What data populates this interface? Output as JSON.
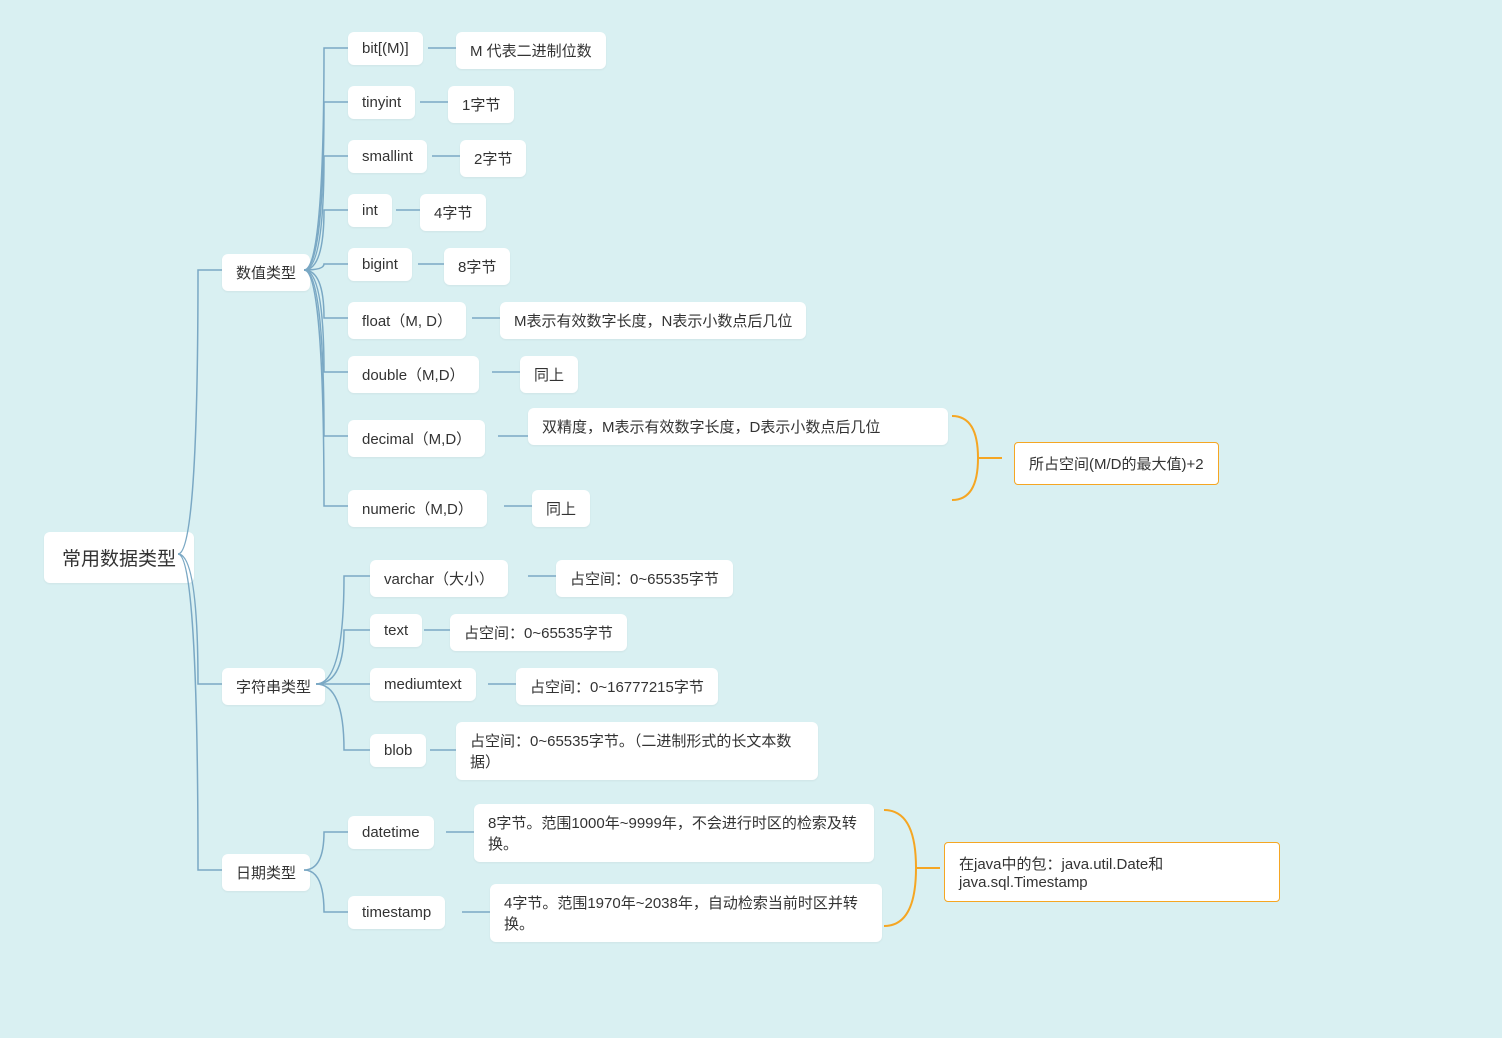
{
  "root": "常用数据类型",
  "categories": {
    "numeric": {
      "label": "数值类型",
      "items": [
        {
          "name": "bit[(M)]",
          "desc": "M 代表二进制位数"
        },
        {
          "name": "tinyint",
          "desc": "1字节"
        },
        {
          "name": "smallint",
          "desc": "2字节"
        },
        {
          "name": "int",
          "desc": "4字节"
        },
        {
          "name": "bigint",
          "desc": "8字节"
        },
        {
          "name": "float（M, D）",
          "desc": "M表示有效数字长度，N表示小数点后几位"
        },
        {
          "name": "double（M,D）",
          "desc": "同上"
        },
        {
          "name": "decimal（M,D）",
          "desc": "双精度，M表示有效数字长度，D表示小数点后几位"
        },
        {
          "name": "numeric（M,D）",
          "desc": "同上"
        }
      ]
    },
    "string": {
      "label": "字符串类型",
      "items": [
        {
          "name": "varchar（大小）",
          "desc": "占空间：0~65535字节"
        },
        {
          "name": "text",
          "desc": "占空间：0~65535字节"
        },
        {
          "name": "mediumtext",
          "desc": "占空间：0~16777215字节"
        },
        {
          "name": "blob",
          "desc": "占空间：0~65535字节。（二进制形式的长文本数据）"
        }
      ]
    },
    "date": {
      "label": "日期类型",
      "items": [
        {
          "name": "datetime",
          "desc": "8字节。范围1000年~9999年，不会进行时区的检索及转换。"
        },
        {
          "name": "timestamp",
          "desc": "4字节。范围1970年~2038年，自动检索当前时区并转换。"
        }
      ]
    }
  },
  "annotations": {
    "decimal_numeric": "所占空间(M/D的最大值)+2",
    "date_java": "在java中的包：java.util.Date和java.sql.Timestamp"
  }
}
